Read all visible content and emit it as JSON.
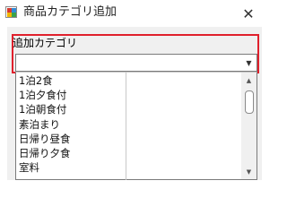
{
  "window": {
    "title": "商品カテゴリ追加",
    "close_glyph": "✕"
  },
  "form": {
    "field_label": "追加カテゴリ",
    "combo_value": "",
    "combo_arrow_glyph": "▼",
    "highlight_color": "#e0202c"
  },
  "dropdown": {
    "items": [
      "1泊2食",
      "1泊夕食付",
      "1泊朝食付",
      "素泊まり",
      "日帰り昼食",
      "日帰り夕食",
      "室料"
    ]
  },
  "scrollbar": {
    "up_glyph": "▲",
    "down_glyph": "▼"
  }
}
